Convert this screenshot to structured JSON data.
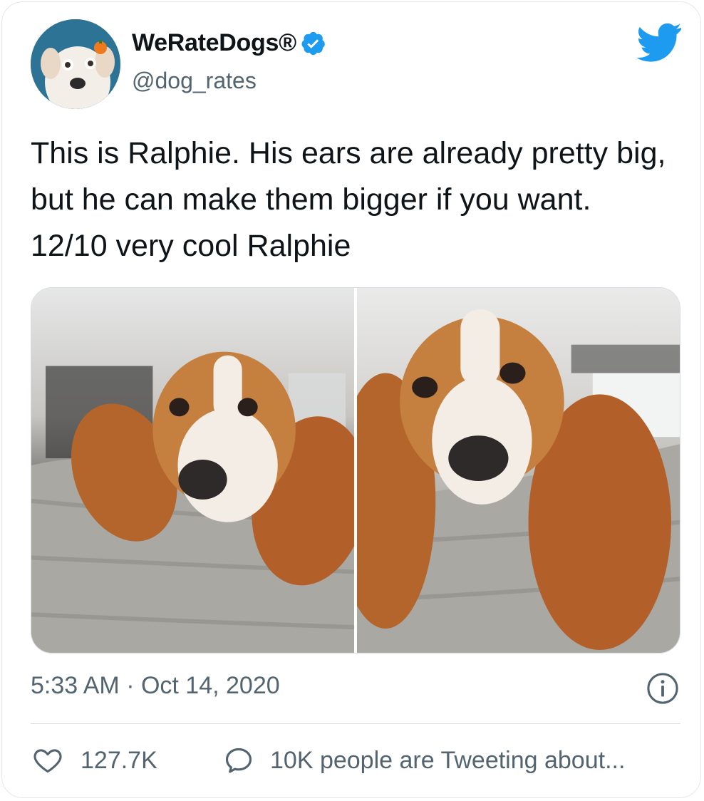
{
  "tweet": {
    "display_name": "WeRateDogs®",
    "handle": "@dog_rates",
    "text": "This is Ralphie. His ears are already pretty big, but he can make them bigger if you want. 12/10 very cool Ralphie",
    "timestamp": "5:33 AM · Oct 14, 2020",
    "likes": "127.7K",
    "conversation": "10K people are Tweeting about..."
  },
  "icons": {
    "verified": "verified-badge-icon",
    "brand": "twitter-bird-icon",
    "info": "info-icon",
    "like": "heart-icon",
    "reply": "speech-bubble-icon"
  },
  "colors": {
    "brand_blue": "#1d9bf0",
    "text_primary": "#0f1419",
    "text_secondary": "#536471",
    "divider": "#d6dde2"
  }
}
